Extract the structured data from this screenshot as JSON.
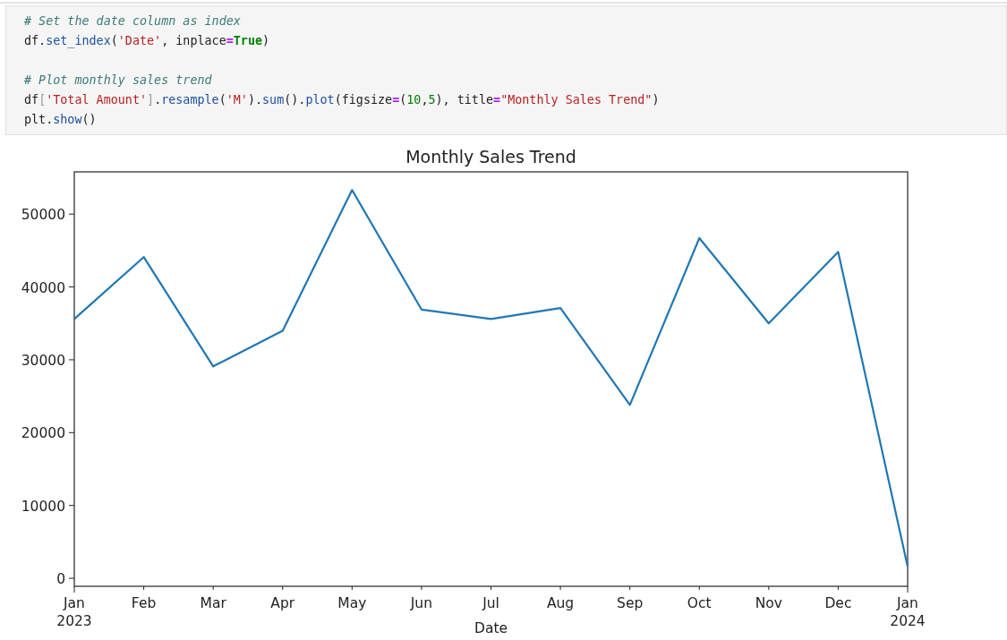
{
  "code_cell": {
    "lines": [
      {
        "kind": "code",
        "tokens": [
          {
            "kind": "comment",
            "text": "# Set the date column as index"
          }
        ]
      },
      {
        "kind": "code",
        "tokens": [
          {
            "kind": "plain",
            "text": "df."
          },
          {
            "kind": "func",
            "text": "set_index"
          },
          {
            "kind": "plain",
            "text": "("
          },
          {
            "kind": "string",
            "text": "'Date'"
          },
          {
            "kind": "plain",
            "text": ", inplace"
          },
          {
            "kind": "op",
            "text": "="
          },
          {
            "kind": "keyword",
            "text": "True"
          },
          {
            "kind": "plain",
            "text": ")"
          }
        ]
      },
      {
        "kind": "blank"
      },
      {
        "kind": "code",
        "tokens": [
          {
            "kind": "comment",
            "text": "# Plot monthly sales trend"
          }
        ]
      },
      {
        "kind": "code",
        "tokens": [
          {
            "kind": "plain",
            "text": "df"
          },
          {
            "kind": "bracket",
            "text": "["
          },
          {
            "kind": "string",
            "text": "'Total Amount'"
          },
          {
            "kind": "bracket",
            "text": "]"
          },
          {
            "kind": "plain",
            "text": "."
          },
          {
            "kind": "func",
            "text": "resample"
          },
          {
            "kind": "plain",
            "text": "("
          },
          {
            "kind": "string",
            "text": "'M'"
          },
          {
            "kind": "plain",
            "text": ")."
          },
          {
            "kind": "func",
            "text": "sum"
          },
          {
            "kind": "plain",
            "text": "()."
          },
          {
            "kind": "func",
            "text": "plot"
          },
          {
            "kind": "plain",
            "text": "(figsize"
          },
          {
            "kind": "op",
            "text": "="
          },
          {
            "kind": "plain",
            "text": "("
          },
          {
            "kind": "number",
            "text": "10"
          },
          {
            "kind": "plain",
            "text": ","
          },
          {
            "kind": "number",
            "text": "5"
          },
          {
            "kind": "plain",
            "text": "), title"
          },
          {
            "kind": "op",
            "text": "="
          },
          {
            "kind": "string",
            "text": "\"Monthly Sales Trend\""
          },
          {
            "kind": "plain",
            "text": ")"
          }
        ]
      },
      {
        "kind": "code",
        "tokens": [
          {
            "kind": "plain",
            "text": "plt."
          },
          {
            "kind": "func",
            "text": "show"
          },
          {
            "kind": "plain",
            "text": "()"
          }
        ]
      }
    ]
  },
  "output": {
    "chart_data": {
      "type": "line",
      "title": "Monthly Sales Trend",
      "xlabel": "Date",
      "categories": [
        "Jan 2023",
        "Feb",
        "Mar",
        "Apr",
        "May",
        "Jun",
        "Jul",
        "Aug",
        "Sep",
        "Oct",
        "Nov",
        "Dec",
        "Jan 2024"
      ],
      "ylim": [
        -1100,
        55800
      ],
      "yticks": [
        0,
        10000,
        20000,
        30000,
        40000,
        50000
      ],
      "series": [
        {
          "color": "#1f77b4",
          "values": [
            35600,
            44100,
            29100,
            34000,
            53300,
            36900,
            35600,
            37100,
            23800,
            46700,
            35000,
            44800,
            1600
          ]
        }
      ]
    }
  }
}
